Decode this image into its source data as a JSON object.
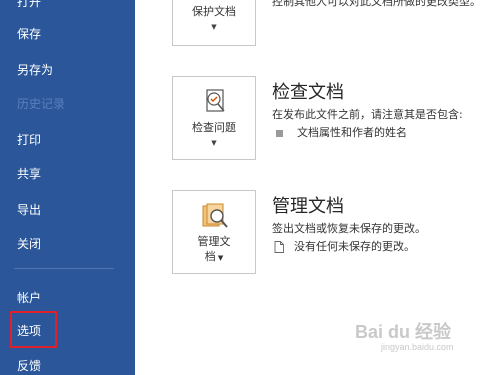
{
  "sidebar": {
    "items": [
      {
        "label": "打开"
      },
      {
        "label": "保存"
      },
      {
        "label": "另存为"
      },
      {
        "label": "历史记录"
      },
      {
        "label": "打印"
      },
      {
        "label": "共享"
      },
      {
        "label": "导出"
      },
      {
        "label": "关闭"
      },
      {
        "label": "帐户"
      },
      {
        "label": "选项"
      },
      {
        "label": "反馈"
      }
    ]
  },
  "sections": {
    "protect": {
      "button_label": "保护文档",
      "description": "控制其他人可以对此文档所做的更改类型。"
    },
    "inspect": {
      "button_label": "检查问题",
      "title": "检查文档",
      "description": "在发布此文件之前，请注意其是否包含:",
      "bullet": "文档属性和作者的姓名"
    },
    "manage": {
      "button_label_line1": "管理文",
      "button_label_line2": "档",
      "title": "管理文档",
      "description": "签出文档或恢复未保存的更改。",
      "bullet": "没有任何未保存的更改。"
    }
  },
  "colors": {
    "sidebar_bg": "#2b579a",
    "highlight_border": "#e0202a"
  },
  "watermark": {
    "text": "Bai du 经验",
    "sub": "jingyan.baidu.com"
  }
}
